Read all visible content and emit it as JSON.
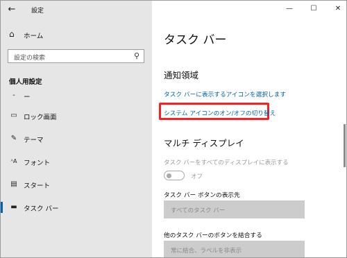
{
  "window": {
    "title": "設定",
    "back_glyph": "←",
    "minimize_glyph": "—",
    "maximize_glyph": "☐",
    "close_glyph": "✕"
  },
  "sidebar": {
    "home_label": "ホーム",
    "home_glyph": "⌂",
    "search_placeholder": "設定の検索",
    "search_glyph": "⚲",
    "section_heading": "個人用設定",
    "items": [
      {
        "label": "ー",
        "glyph": "-"
      },
      {
        "label": "ロック画面",
        "glyph": "▭"
      },
      {
        "label": "テーマ",
        "glyph": "✎"
      },
      {
        "label": "フォント",
        "glyph": "ᴬA"
      },
      {
        "label": "スタート",
        "glyph": "▤"
      },
      {
        "label": "タスク バー",
        "glyph": "▬"
      }
    ],
    "selected_index": 5
  },
  "main": {
    "title": "タスク バー",
    "notification_area": {
      "heading": "通知領域",
      "link1": "タスク バーに表示するアイコンを選択します",
      "link2": "システム アイコンのオン/オフの切り替え"
    },
    "multi_display": {
      "heading": "マルチ ディスプレイ",
      "show_on_all_label": "タスク バーをすべてのディスプレイに表示する",
      "toggle_state": "オフ",
      "buttons_location_label": "タスク バー ボタンの表示先",
      "buttons_location_value": "すべてのタスク バー",
      "combine_label": "他のタスク バーのボタンを結合する",
      "combine_value": "常に結合、ラベルを非表示"
    }
  },
  "colors": {
    "accent": "#0063b1",
    "highlight": "#ff1d1d",
    "sidebar_bg": "#e6e6e6"
  }
}
